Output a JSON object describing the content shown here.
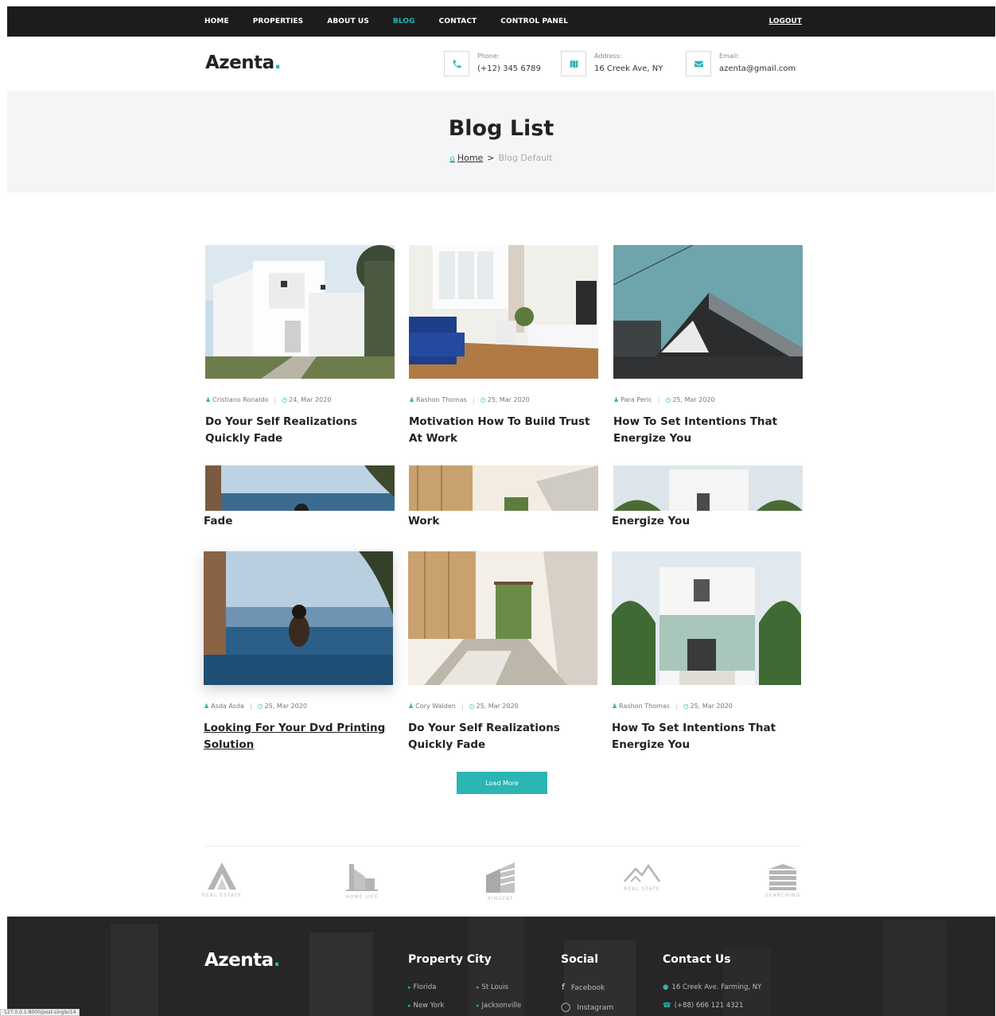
{
  "nav": {
    "items": [
      {
        "label": "HOME",
        "active": false
      },
      {
        "label": "PROPERTIES",
        "active": false
      },
      {
        "label": "ABOUT US",
        "active": false
      },
      {
        "label": "BLOG",
        "active": true
      },
      {
        "label": "CONTACT",
        "active": false
      },
      {
        "label": "CONTROL PANEL",
        "active": false
      }
    ],
    "logout": "LOGOUT"
  },
  "brand": {
    "name": "Azenta",
    "dot": ".",
    "accent": "#2bb5b3"
  },
  "contacts": {
    "phone": {
      "label": "Phone:",
      "value": "(+12) 345 6789",
      "icon": "phone-icon"
    },
    "address": {
      "label": "Address:",
      "value": "16 Creek Ave, NY",
      "icon": "map-icon"
    },
    "email": {
      "label": "Email:",
      "value": "azenta@gmail.com",
      "icon": "envelope-icon"
    }
  },
  "banner": {
    "title": "Blog List",
    "crumb_home": "Home",
    "crumb_sep": ">",
    "crumb_current": "Blog Default"
  },
  "posts_row1": [
    {
      "author": "Cristiano Ronaldo",
      "date": "24, Mar 2020",
      "title": "Do Your Self Realizations Quickly Fade"
    },
    {
      "author": "Rashon Thomas",
      "date": "25, Mar 2020",
      "title": "Motivation How To Build Trust At Work"
    },
    {
      "author": "Para Peric",
      "date": "25, Mar 2020",
      "title": "How To Set Intentions That Energize You"
    }
  ],
  "strip_titles": [
    "Fade",
    "Work",
    "Energize You"
  ],
  "posts_row2": [
    {
      "author": "Asda Asda",
      "date": "25, Mar 2020",
      "title": "Looking For Your Dvd Printing Solution"
    },
    {
      "author": "Cory Walden",
      "date": "25, Mar 2020",
      "title": "Do Your Self Realizations Quickly Fade"
    },
    {
      "author": "Rashon Thomas",
      "date": "25, Mar 2020",
      "title": "How To Set Intentions That Energize You"
    }
  ],
  "load_more": "Load More",
  "partners": [
    "REAL ESTATE",
    "HOME LIFE",
    "KINGFAT",
    "REAL STATE",
    "SEARCHING"
  ],
  "footer": {
    "logo": "Azenta",
    "property_city": {
      "heading": "Property City",
      "links": [
        "Florida",
        "St Louis",
        "New York",
        "Jacksonville"
      ]
    },
    "social": {
      "heading": "Social",
      "links": [
        "Facebook",
        "Instagram"
      ]
    },
    "contact": {
      "heading": "Contact Us",
      "address": "16 Creek Ave. Farming, NY",
      "phone": "(+88) 666 121 4321"
    }
  },
  "status_url": "127.0.0.1:8000/post-single/14"
}
